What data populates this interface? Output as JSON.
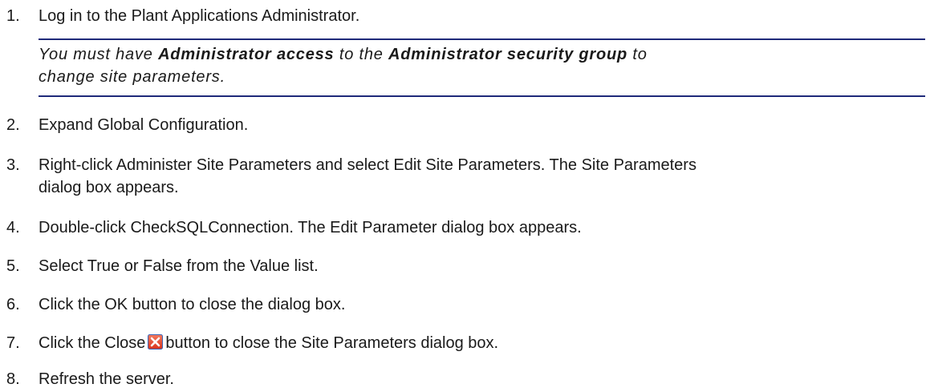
{
  "steps": [
    {
      "num": "1.",
      "text": "Log in to the Plant Applications Administrator."
    },
    {
      "num": "2.",
      "text": "Expand Global Configuration."
    },
    {
      "num": "3.",
      "text_line1": "Right-click Administer Site Parameters and select Edit Site Parameters. The Site Parameters",
      "text_line2": "dialog box appears."
    },
    {
      "num": "4.",
      "text": "Double-click CheckSQLConnection. The Edit Parameter dialog box appears."
    },
    {
      "num": "5.",
      "text": "Select True or False from the Value list."
    },
    {
      "num": "6.",
      "text": "Click the OK button to close the dialog box."
    },
    {
      "num": "7.",
      "text_before": "Click the Close",
      "text_after": "button to close the Site Parameters dialog box.",
      "icon": "close-icon"
    },
    {
      "num": "8.",
      "text": "Refresh the server."
    }
  ],
  "note": {
    "part1": "You must have ",
    "bold1": "Administrator access",
    "part2": " to the ",
    "bold2": "Administrator security group",
    "part3": " to",
    "line2": "change site parameters."
  },
  "colors": {
    "rule": "#1f2a7a",
    "text": "#1a1a1a",
    "close_icon_fill": "#e8452e"
  }
}
